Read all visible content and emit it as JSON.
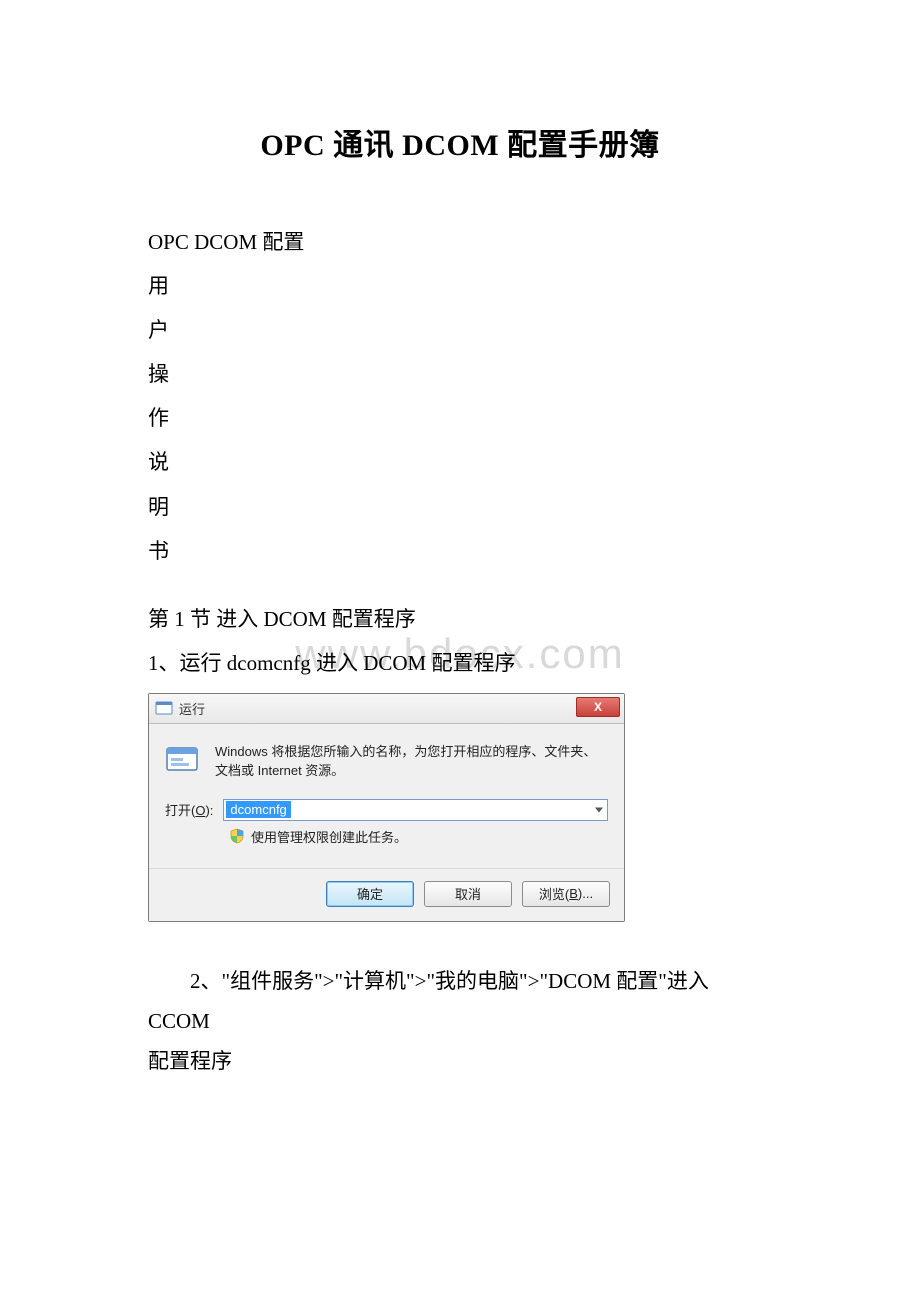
{
  "title": "OPC 通讯 DCOM 配置手册簿",
  "watermark": "www.bdocx.com",
  "intro": {
    "line1": "OPC DCOM 配置",
    "v1": "用",
    "v2": "户",
    "v3": "操",
    "v4": "作",
    "v5": "说",
    "v6": "明",
    "v7": "书"
  },
  "section1": {
    "heading": "第 1 节  进入 DCOM 配置程序",
    "step1": "1、运行 dcomcnfg 进入 DCOM 配置程序"
  },
  "run_dialog": {
    "title": "运行",
    "close_glyph": "X",
    "description": "Windows 将根据您所输入的名称，为您打开相应的程序、文件夹、文档或 Internet 资源。",
    "open_label_prefix": "打开(",
    "open_label_hotkey": "O",
    "open_label_suffix": "):",
    "input_value": "dcomcnfg",
    "admin_text": "使用管理权限创建此任务。",
    "ok_label": "确定",
    "cancel_label": "取消",
    "browse_prefix": "浏览(",
    "browse_hotkey": "B",
    "browse_suffix": ")..."
  },
  "step2": {
    "line1": "2、\"组件服务\">\"计算机\">\"我的电脑\">\"DCOM 配置\"进入 CCOM",
    "line2": "配置程序"
  }
}
